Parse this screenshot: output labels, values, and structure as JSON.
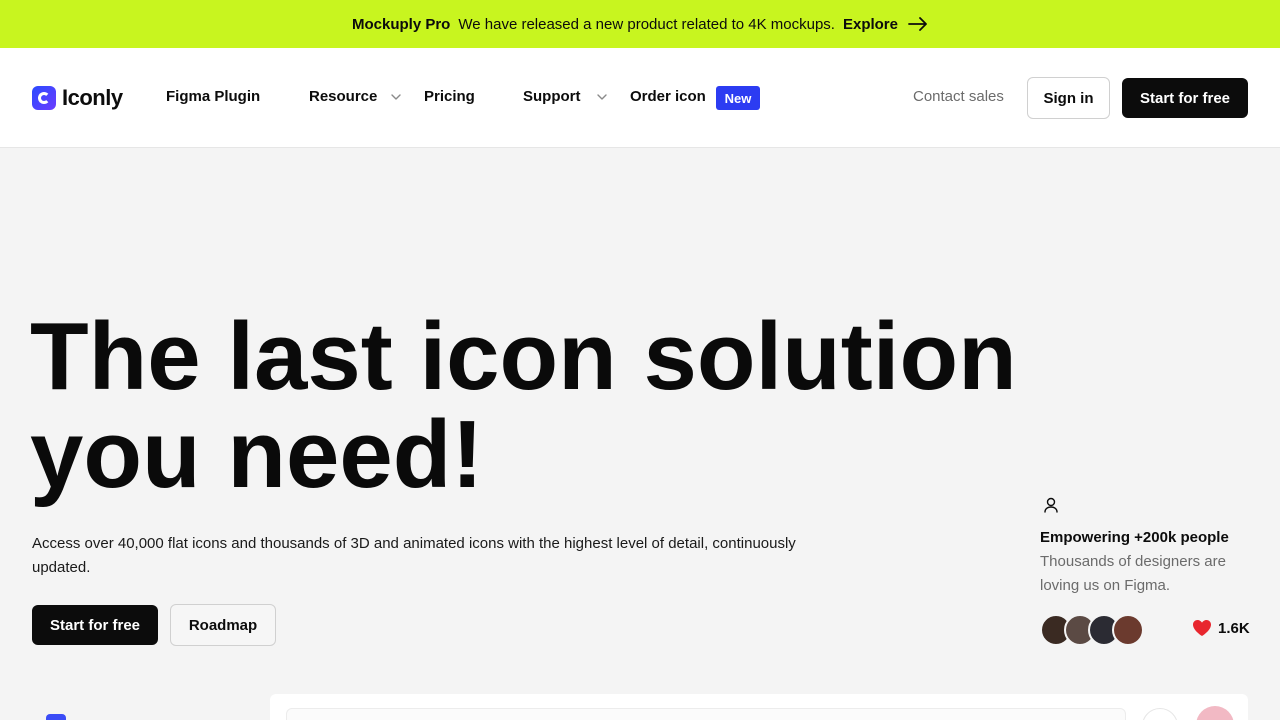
{
  "announcement": {
    "brand": "Mockuply Pro",
    "message": "We have released a new product related to 4K mockups.",
    "cta": "Explore",
    "cta_icon": "arrow-right-icon",
    "background": "#c8f51f"
  },
  "nav": {
    "logo_text": "Iconly",
    "items": [
      {
        "label": "Figma Plugin",
        "has_dropdown": false
      },
      {
        "label": "Resource",
        "has_dropdown": true
      },
      {
        "label": "Pricing",
        "has_dropdown": false
      },
      {
        "label": "Support",
        "has_dropdown": true
      },
      {
        "label": "Order icon",
        "has_dropdown": false
      }
    ],
    "new_badge": "New",
    "contact_sales": "Contact sales",
    "sign_in": "Sign in",
    "start_free": "Start for free",
    "accent": "#2c3cf2"
  },
  "hero": {
    "title": "The last icon solution you need!",
    "subtitle": "Access over 40,000 flat icons and thousands of 3D and animated icons with the highest level of detail, continuously updated.",
    "primary_cta": "Start for free",
    "secondary_cta": "Roadmap"
  },
  "social_proof": {
    "icon": "user-icon",
    "title": "Empowering +200k people",
    "subtitle": "Thousands of designers are loving us on Figma.",
    "avatar_colors": [
      "#3a2a22",
      "#5b4a44",
      "#2b2b33",
      "#6b3a2e"
    ],
    "likes": "1.6K",
    "heart_color": "#e8262e"
  }
}
